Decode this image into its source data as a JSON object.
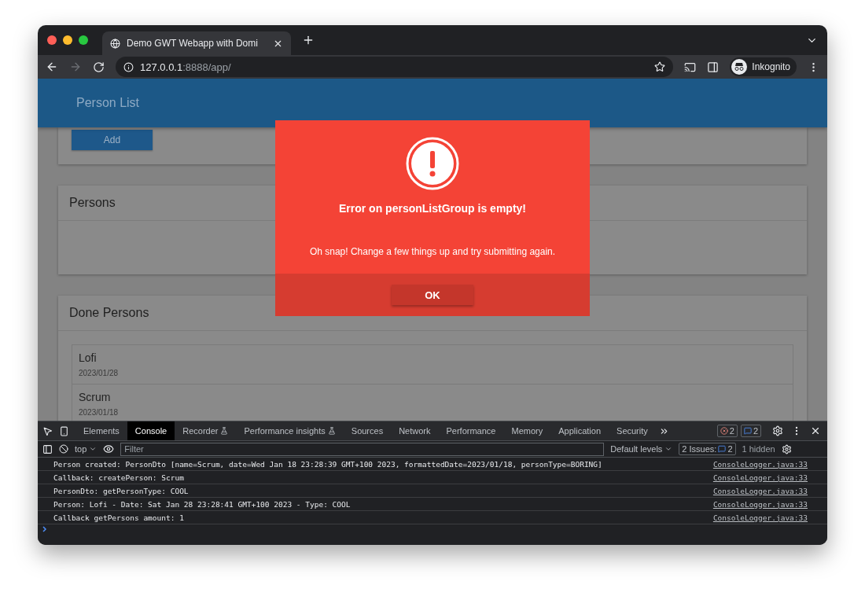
{
  "browser": {
    "tab_title": "Demo GWT Webapp with Domi",
    "url_host": "127.0.0.1",
    "url_path": ":8888/app/",
    "profile_label": "Inkognito"
  },
  "page": {
    "header_title": "Person List",
    "add_button": "Add",
    "sections": [
      {
        "title": "Persons"
      },
      {
        "title": "Done Persons",
        "items": [
          {
            "name": "Lofi",
            "date": "2023/01/28"
          },
          {
            "name": "Scrum",
            "date": "2023/01/18"
          }
        ]
      }
    ]
  },
  "dialog": {
    "title": "Error on personListGroup is empty!",
    "message": "Oh snap! Change a few things up and try submitting again.",
    "ok_button": "OK"
  },
  "devtools": {
    "tabs": [
      {
        "label": "Elements",
        "selected": false,
        "experimental": false
      },
      {
        "label": "Console",
        "selected": true,
        "experimental": false
      },
      {
        "label": "Recorder",
        "selected": false,
        "experimental": true
      },
      {
        "label": "Performance insights",
        "selected": false,
        "experimental": true
      },
      {
        "label": "Sources",
        "selected": false,
        "experimental": false
      },
      {
        "label": "Network",
        "selected": false,
        "experimental": false
      },
      {
        "label": "Performance",
        "selected": false,
        "experimental": false
      },
      {
        "label": "Memory",
        "selected": false,
        "experimental": false
      },
      {
        "label": "Application",
        "selected": false,
        "experimental": false
      },
      {
        "label": "Security",
        "selected": false,
        "experimental": false
      }
    ],
    "error_count": "2",
    "message_count": "2",
    "context": "top",
    "filter_placeholder": "Filter",
    "levels": "Default levels",
    "issues_label": "2 Issues:",
    "issues_count": "2",
    "hidden_label": "1 hidden",
    "logs": [
      {
        "text": "Person created: PersonDto [name=Scrum, date=Wed Jan 18 23:28:39 GMT+100 2023, formattedDate=2023/01/18, personType=BORING]",
        "source": "ConsoleLogger.java:33"
      },
      {
        "text": "Callback: createPerson: Scrum",
        "source": "ConsoleLogger.java:33"
      },
      {
        "text": "PersonDto: getPersonType: COOL",
        "source": "ConsoleLogger.java:33"
      },
      {
        "text": "Person: Lofi - Date: Sat Jan 28 23:28:41 GMT+100 2023 - Type: COOL",
        "source": "ConsoleLogger.java:33"
      },
      {
        "text": "Callback getPersons amount: 1",
        "source": "ConsoleLogger.java:33"
      }
    ]
  }
}
